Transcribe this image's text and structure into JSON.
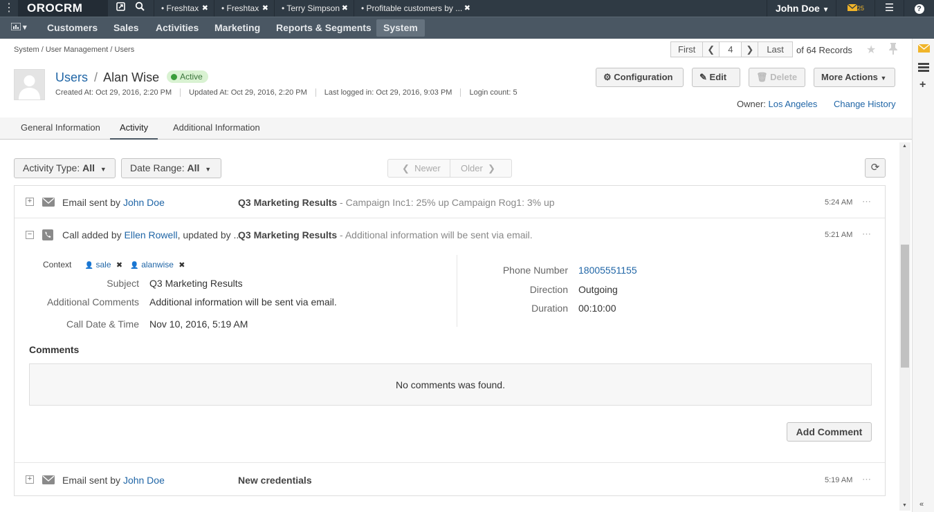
{
  "topbar": {
    "logo": "OROCRM",
    "tabs": [
      {
        "label": "Freshtax"
      },
      {
        "label": "Freshtax"
      },
      {
        "label": "Terry Simpson"
      },
      {
        "label": "Profitable customers by ..."
      }
    ],
    "user": "John Doe",
    "mail_count": "25"
  },
  "menu": {
    "items": [
      "Customers",
      "Sales",
      "Activities",
      "Marketing",
      "Reports & Segments",
      "System"
    ]
  },
  "breadcrumb": "System / User Management / Users",
  "pager": {
    "first": "First",
    "current": "4",
    "last": "Last",
    "records": "of 64 Records"
  },
  "header": {
    "crumb": "Users",
    "separator": "/",
    "name": "Alan Wise",
    "status": "Active",
    "created": "Created At: Oct 29, 2016, 2:20 PM",
    "updated": "Updated At: Oct 29, 2016, 2:20 PM",
    "last_logged": "Last logged in: Oct 29, 2016, 9:03 PM",
    "login_count": "Login count: 5"
  },
  "actions": {
    "configuration": "Configuration",
    "edit": "Edit",
    "delete": "Delete",
    "more": "More Actions"
  },
  "owner": {
    "label": "Owner:",
    "value": "Los Angeles",
    "change_history": "Change History"
  },
  "tabs": [
    "General Information",
    "Activity",
    "Additional Information"
  ],
  "filters": {
    "activity_type_label": "Activity Type:",
    "activity_type_value": "All",
    "date_range_label": "Date Range:",
    "date_range_value": "All",
    "newer": "Newer",
    "older": "Older"
  },
  "activities": [
    {
      "who_prefix": "Email sent by ",
      "who_link": "John Doe",
      "who_suffix": "",
      "subject": "Q3 Marketing Results",
      "description": " - Campaign Inc1: 25% up Campaign Rog1: 3% up",
      "time": "5:24 AM"
    },
    {
      "who_prefix": "Call added by ",
      "who_link": "Ellen Rowell",
      "who_suffix": ", updated by ...",
      "subject": "Q3 Marketing Results",
      "description": " - Additional information will be sent via email.",
      "time": "5:21 AM"
    },
    {
      "who_prefix": "Email sent by ",
      "who_link": "John Doe",
      "who_suffix": "",
      "subject": "New credentials",
      "description": "",
      "time": "5:19 AM"
    }
  ],
  "call_details": {
    "context_label": "Context",
    "context_items": [
      "sale",
      "alanwise"
    ],
    "subject_label": "Subject",
    "subject": "Q3 Marketing Results",
    "comments_label": "Additional Comments",
    "comments": "Additional information will be sent via email.",
    "datetime_label": "Call Date & Time",
    "datetime": "Nov 10, 2016, 5:19 AM",
    "phone_label": "Phone Number",
    "phone": "18005551155",
    "direction_label": "Direction",
    "direction": "Outgoing",
    "duration_label": "Duration",
    "duration": "00:10:00"
  },
  "comments": {
    "title": "Comments",
    "empty": "No comments was found.",
    "add": "Add Comment"
  }
}
